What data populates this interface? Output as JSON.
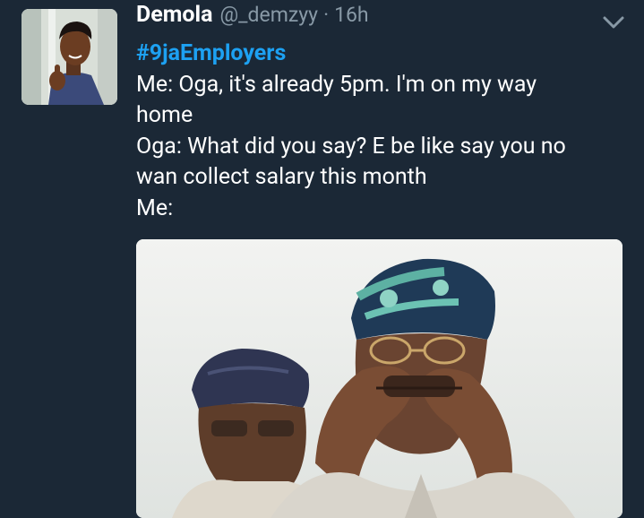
{
  "tweet": {
    "author_name": "Demola",
    "handle": "@_demzyy",
    "separator": "·",
    "time": "16h",
    "hashtag": "#9jaEmployers",
    "lines": [
      "Me: Oga, it's already 5pm. I'm on my way",
      "home",
      "Oga: What did you say? E be like say you no",
      "wan collect salary this month",
      "Me:"
    ],
    "menu_icon": "chevron-down-icon",
    "colors": {
      "background": "#1b2836",
      "text": "#ffffff",
      "muted": "#8899a6",
      "hashtag": "#1da1f2"
    }
  }
}
